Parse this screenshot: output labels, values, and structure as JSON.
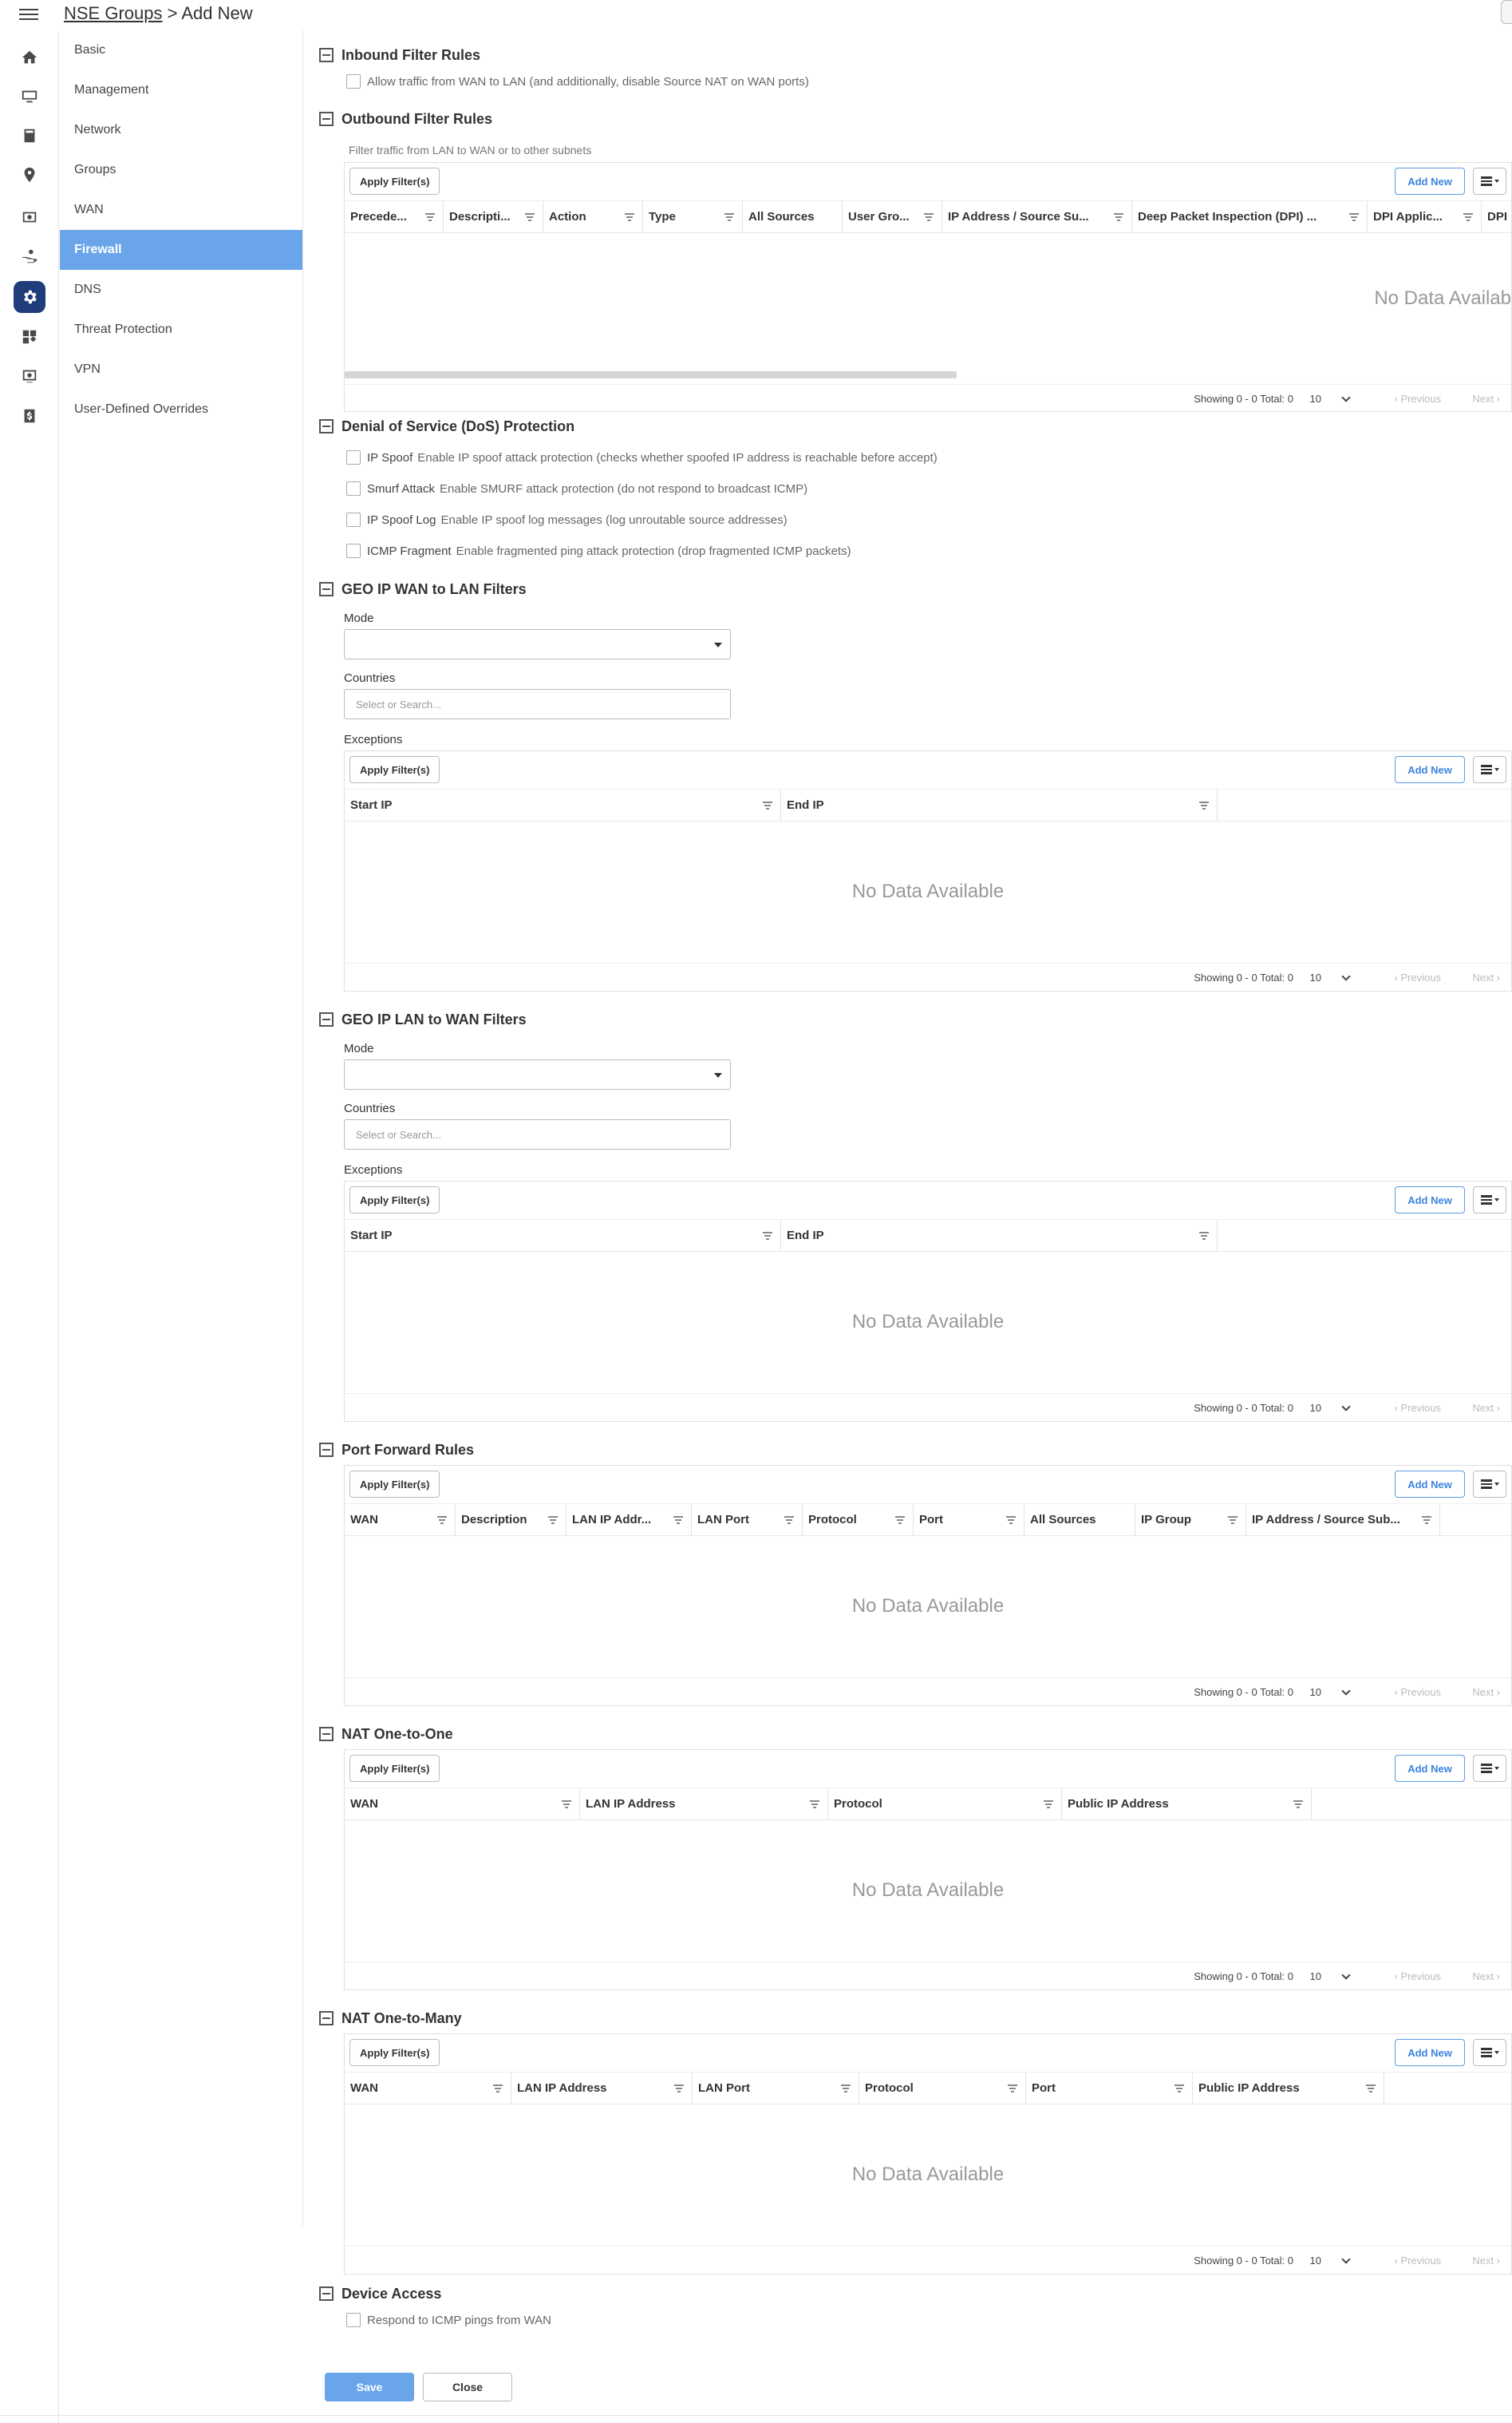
{
  "breadcrumb": {
    "parent": "NSE Groups",
    "separator": " > ",
    "current": "Add New"
  },
  "rail_icons": [
    "home-icon",
    "monitor-icon",
    "calculator-icon",
    "location-pin-icon",
    "money-icon",
    "hand-coins-icon",
    "gear-icon",
    "widgets-icon",
    "screen-cog-icon",
    "dollar-box-icon"
  ],
  "subnav": {
    "items": [
      "Basic",
      "Management",
      "Network",
      "Groups",
      "WAN",
      "Firewall",
      "DNS",
      "Threat Protection",
      "VPN",
      "User-Defined Overrides"
    ],
    "active": "Firewall"
  },
  "common": {
    "apply_filters": "Apply Filter(s)",
    "add_new": "Add New",
    "no_data": "No Data Available",
    "showing": "Showing 0 - 0 Total: 0",
    "page_size": "10",
    "previous": "‹ Previous",
    "next": "Next ›"
  },
  "inbound": {
    "title": "Inbound Filter Rules",
    "checkbox": "Allow traffic from WAN to LAN (and additionally, disable Source NAT on WAN ports)"
  },
  "outbound": {
    "title": "Outbound Filter Rules",
    "hint": "Filter traffic from LAN to WAN or to other subnets",
    "columns": [
      "Precede...",
      "Descripti...",
      "Action",
      "Type",
      "All Sources",
      "User Gro...",
      "IP Address / Source Su...",
      "Deep Packet Inspection (DPI) ...",
      "DPI Applic...",
      "DPI"
    ],
    "no_data": "No Data Availab"
  },
  "dos": {
    "title": "Denial of Service (DoS) Protection",
    "items": [
      {
        "label": "IP Spoof",
        "desc": "Enable IP spoof attack protection (checks whether spoofed IP address is reachable before accept)"
      },
      {
        "label": "Smurf Attack",
        "desc": "Enable SMURF attack protection (do not respond to broadcast ICMP)"
      },
      {
        "label": "IP Spoof Log",
        "desc": "Enable IP spoof log messages (log unroutable source addresses)"
      },
      {
        "label": "ICMP Fragment",
        "desc": "Enable fragmented ping attack protection (drop fragmented ICMP packets)"
      }
    ]
  },
  "geo_wan_lan": {
    "title": "GEO IP WAN to LAN Filters",
    "mode_label": "Mode",
    "countries_label": "Countries",
    "countries_placeholder": "Select or Search...",
    "exceptions_label": "Exceptions",
    "columns": [
      "Start IP",
      "End IP"
    ]
  },
  "geo_lan_wan": {
    "title": "GEO IP LAN to WAN Filters",
    "mode_label": "Mode",
    "countries_label": "Countries",
    "countries_placeholder": "Select or Search...",
    "exceptions_label": "Exceptions",
    "columns": [
      "Start IP",
      "End IP"
    ]
  },
  "port_forward": {
    "title": "Port Forward Rules",
    "columns": [
      "WAN",
      "Description",
      "LAN IP Addr...",
      "LAN Port",
      "Protocol",
      "Port",
      "All Sources",
      "IP Group",
      "IP Address / Source Sub..."
    ]
  },
  "nat_one_one": {
    "title": "NAT One-to-One",
    "columns": [
      "WAN",
      "LAN IP Address",
      "Protocol",
      "Public IP Address"
    ]
  },
  "nat_one_many": {
    "title": "NAT One-to-Many",
    "columns": [
      "WAN",
      "LAN IP Address",
      "LAN Port",
      "Protocol",
      "Port",
      "Public IP Address"
    ]
  },
  "device_access": {
    "title": "Device Access",
    "checkbox": "Respond to ICMP pings from WAN"
  },
  "actions": {
    "save": "Save",
    "close": "Close"
  },
  "colors": {
    "accent": "#6aa5ea",
    "rail_active": "#1f3d7a",
    "link_blue": "#3b84dd"
  }
}
